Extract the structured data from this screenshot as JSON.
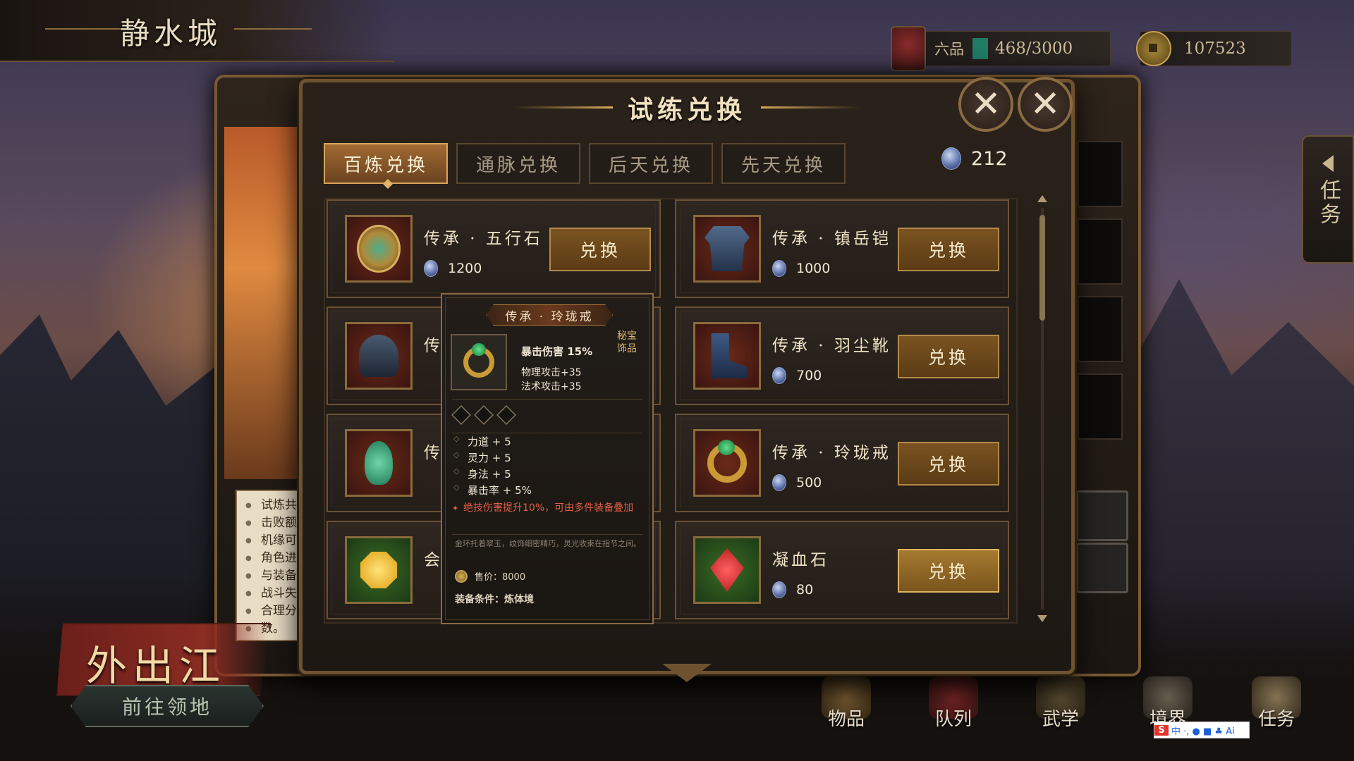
{
  "city": {
    "name": "静水城"
  },
  "resources": {
    "rank_label": "六品",
    "rank_progress": "468/3000",
    "rank_progress_fraction": 0.156,
    "coins": "107523"
  },
  "quest_tab": {
    "label": "任务"
  },
  "notice": {
    "lines": [
      "试炼共",
      "击败额",
      "机缘可",
      "角色进",
      "与装备",
      "战斗失",
      "合理分",
      "数。"
    ]
  },
  "go_out": {
    "label": "外出江湖"
  },
  "go_territory": {
    "label": "前往领地"
  },
  "bottom_nav": [
    {
      "label": "物品",
      "icon": "bag-icon"
    },
    {
      "label": "队列",
      "icon": "flag-icon"
    },
    {
      "label": "武学",
      "icon": "book-icon"
    },
    {
      "label": "境界",
      "icon": "meditation-icon"
    },
    {
      "label": "任务",
      "icon": "scroll-icon"
    }
  ],
  "dialog": {
    "title": "试练兑换",
    "tabs": [
      {
        "label": "百炼兑换",
        "active": true
      },
      {
        "label": "通脉兑换",
        "active": false
      },
      {
        "label": "后天兑换",
        "active": false
      },
      {
        "label": "先天兑换",
        "active": false
      }
    ],
    "currency": "212",
    "exchange_label": "兑换",
    "items": [
      {
        "name": "传承 · 五行石",
        "price": "1200",
        "icon": "medal-icon"
      },
      {
        "name": "传承 · 镇岳铠",
        "price": "1000",
        "icon": "armor-icon"
      },
      {
        "name": "传",
        "price": "",
        "icon": "helmet-icon"
      },
      {
        "name": "传承 · 羽尘靴",
        "price": "700",
        "icon": "boots-icon"
      },
      {
        "name": "传",
        "price": "",
        "icon": "jade-pendant-icon"
      },
      {
        "name": "传承 · 玲珑戒",
        "price": "500",
        "icon": "ring-icon"
      },
      {
        "name": "会",
        "price": "",
        "icon": "topaz-icon"
      },
      {
        "name": "凝血石",
        "price": "80",
        "icon": "ruby-icon"
      }
    ]
  },
  "tooltip": {
    "title": "传承 · 玲珑戒",
    "type_line1": "秘宝",
    "type_line2": "饰品",
    "main_stat": "暴击伤害 15%",
    "stat1": "物理攻击+35",
    "stat2": "法术攻击+35",
    "attributes": [
      "力道 + 5",
      "灵力 + 5",
      "身法 + 5",
      "暴击率 + 5%"
    ],
    "effect": "绝技伤害提升10%，可由多件装备叠加",
    "lore": "金环托着翠玉，纹饰细密精巧，灵光收束在指节之间。",
    "sell_price": "售价：8000",
    "requirement": "装备条件：炼体境"
  },
  "ime": {
    "text": "中 ·, ● ■ ♣ Ai"
  }
}
